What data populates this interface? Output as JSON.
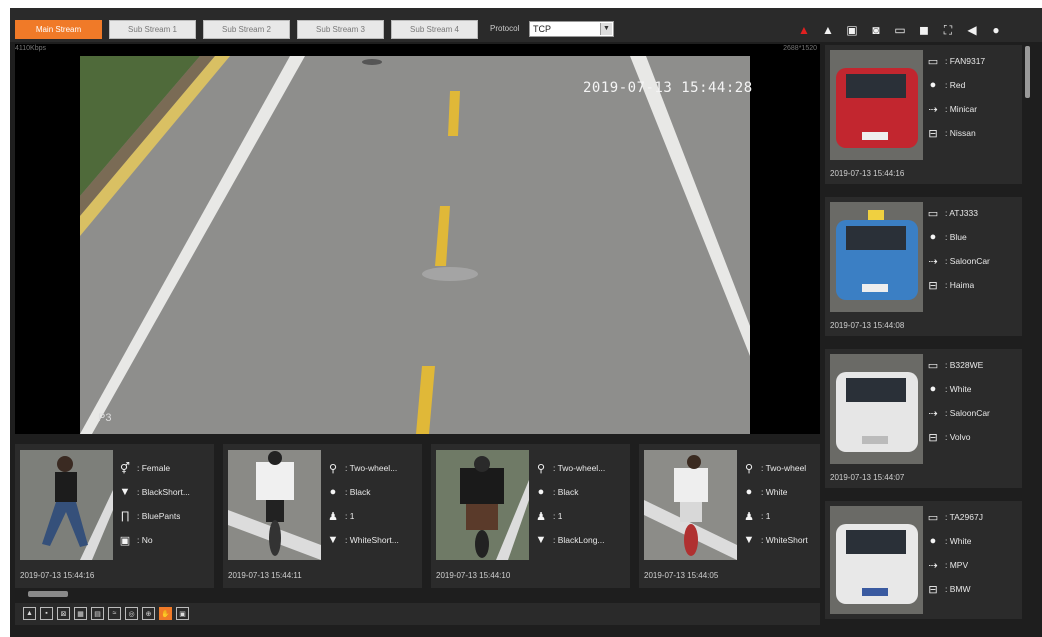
{
  "toolbar": {
    "streams": [
      "Main Stream",
      "Sub Stream 1",
      "Sub Stream 2",
      "Sub Stream 3",
      "Sub Stream 4"
    ],
    "active_stream": "Main Stream",
    "protocol_label": "Protocol",
    "protocol_value": "TCP",
    "icons": [
      "alarm-icon",
      "person-icon",
      "snapshot-icon",
      "camera-icon",
      "screen-icon",
      "record-icon",
      "fullscreen-icon",
      "speaker-icon",
      "microphone-icon"
    ]
  },
  "video": {
    "bitrate": "4110Kbps",
    "resolution": "2688*1520",
    "timestamp": "2019-07-13 15:44:28",
    "channel_label": "P3"
  },
  "persons": [
    {
      "attrs": [
        {
          "icon": "gender-icon",
          "text": ": Female"
        },
        {
          "icon": "top-icon",
          "text": ": BlackShort..."
        },
        {
          "icon": "pants-icon",
          "text": ": BluePants"
        },
        {
          "icon": "bag-icon",
          "text": ": No"
        }
      ],
      "time": "2019-07-13 15:44:16"
    },
    {
      "attrs": [
        {
          "icon": "bike-icon",
          "text": ": Two-wheel..."
        },
        {
          "icon": "color-icon",
          "text": ": Black"
        },
        {
          "icon": "rider-icon",
          "text": ": 1"
        },
        {
          "icon": "top-icon",
          "text": ": WhiteShort..."
        }
      ],
      "time": "2019-07-13 15:44:11"
    },
    {
      "attrs": [
        {
          "icon": "bike-icon",
          "text": ": Two-wheel..."
        },
        {
          "icon": "color-icon",
          "text": ": Black"
        },
        {
          "icon": "rider-icon",
          "text": ": 1"
        },
        {
          "icon": "top-icon",
          "text": ": BlackLong..."
        }
      ],
      "time": "2019-07-13 15:44:10"
    },
    {
      "attrs": [
        {
          "icon": "bike-icon",
          "text": ": Two-wheel"
        },
        {
          "icon": "color-icon",
          "text": ": White"
        },
        {
          "icon": "rider-icon",
          "text": ": 1"
        },
        {
          "icon": "top-icon",
          "text": ": WhiteShort"
        }
      ],
      "time": "2019-07-13 15:44:05"
    }
  ],
  "vehicles": [
    {
      "plate": ": FAN9317",
      "color": ": Red",
      "type": ": Minicar",
      "brand": ": Nissan",
      "time": "2019-07-13 15:44:16",
      "car_color": "#c2262f"
    },
    {
      "plate": ": ATJ333",
      "color": ": Blue",
      "type": ": SaloonCar",
      "brand": ": Haima",
      "time": "2019-07-13 15:44:08",
      "car_color": "#3b7fc4"
    },
    {
      "plate": ": B328WE",
      "color": ": White",
      "type": ": SaloonCar",
      "brand": ": Volvo",
      "time": "2019-07-13 15:44:07",
      "car_color": "#e6e6e6"
    },
    {
      "plate": ": TA2967J",
      "color": ": White",
      "type": ": MPV",
      "brand": ": BMW",
      "time": "",
      "car_color": "#e8e8e8"
    }
  ],
  "bottom": {
    "icons": [
      "fit-window-icon",
      "original-size-icon",
      "zoom-icon",
      "smart-icon",
      "rule-icon",
      "flow-icon",
      "focus-icon",
      "target-icon",
      "hand-icon",
      "vehicle-icon"
    ],
    "active_icon": "hand-icon"
  },
  "colors": {
    "accent": "#f07a28",
    "panel": "#2b2b2b",
    "background": "#1e1e1e"
  }
}
